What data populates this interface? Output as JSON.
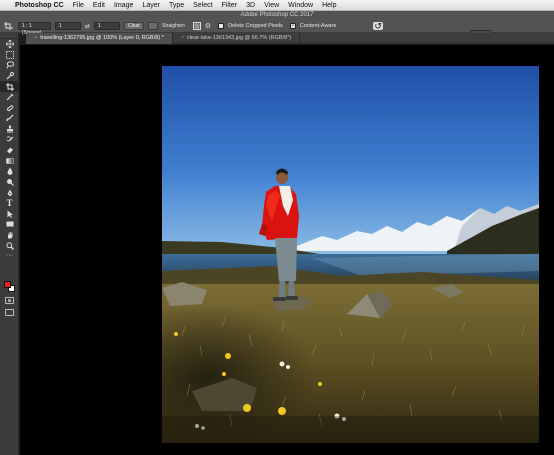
{
  "menubar": {
    "app_name": "Photoshop CC",
    "items": [
      "File",
      "Edit",
      "Image",
      "Layer",
      "Type",
      "Select",
      "Filter",
      "3D",
      "View",
      "Window",
      "Help"
    ]
  },
  "window": {
    "title": "Adobe Photoshop CC 2017"
  },
  "options": {
    "ratio_value": "1 : 1 (Square)",
    "width_value": "1",
    "height_value": "1",
    "clear_label": "Clear",
    "straighten_label": "Straighten",
    "delete_cropped_label": "Delete Cropped Pixels",
    "delete_cropped_checked": false,
    "content_aware_label": "Content-Aware",
    "content_aware_checked": true
  },
  "tabs": [
    {
      "label": "travelling-1362795.jpg @ 100% (Layer 0, RGB/8) *",
      "active": true
    },
    {
      "label": "clear-lake-1361343.jpg @ 66.7% (RGB/8*)",
      "active": false
    }
  ],
  "tools": [
    "move-tool",
    "marquee-tool",
    "lasso-tool",
    "quick-select-tool",
    "crop-tool",
    "eyedropper-tool",
    "healing-tool",
    "brush-tool",
    "clone-stamp-tool",
    "history-brush-tool",
    "eraser-tool",
    "gradient-tool",
    "blur-tool",
    "dodge-tool",
    "pen-tool",
    "type-tool",
    "path-select-tool",
    "rectangle-tool",
    "hand-tool",
    "zoom-tool",
    "more-tools-icon"
  ],
  "colors": {
    "foreground": "#e62314",
    "background": "#ffffff",
    "workspace": "#000000",
    "ui": "#535353"
  },
  "image": {
    "description_elements": [
      "blue-sky",
      "snow-mountains",
      "lake",
      "man-red-jacket",
      "meadow",
      "rocks",
      "yellow-flowers"
    ]
  }
}
